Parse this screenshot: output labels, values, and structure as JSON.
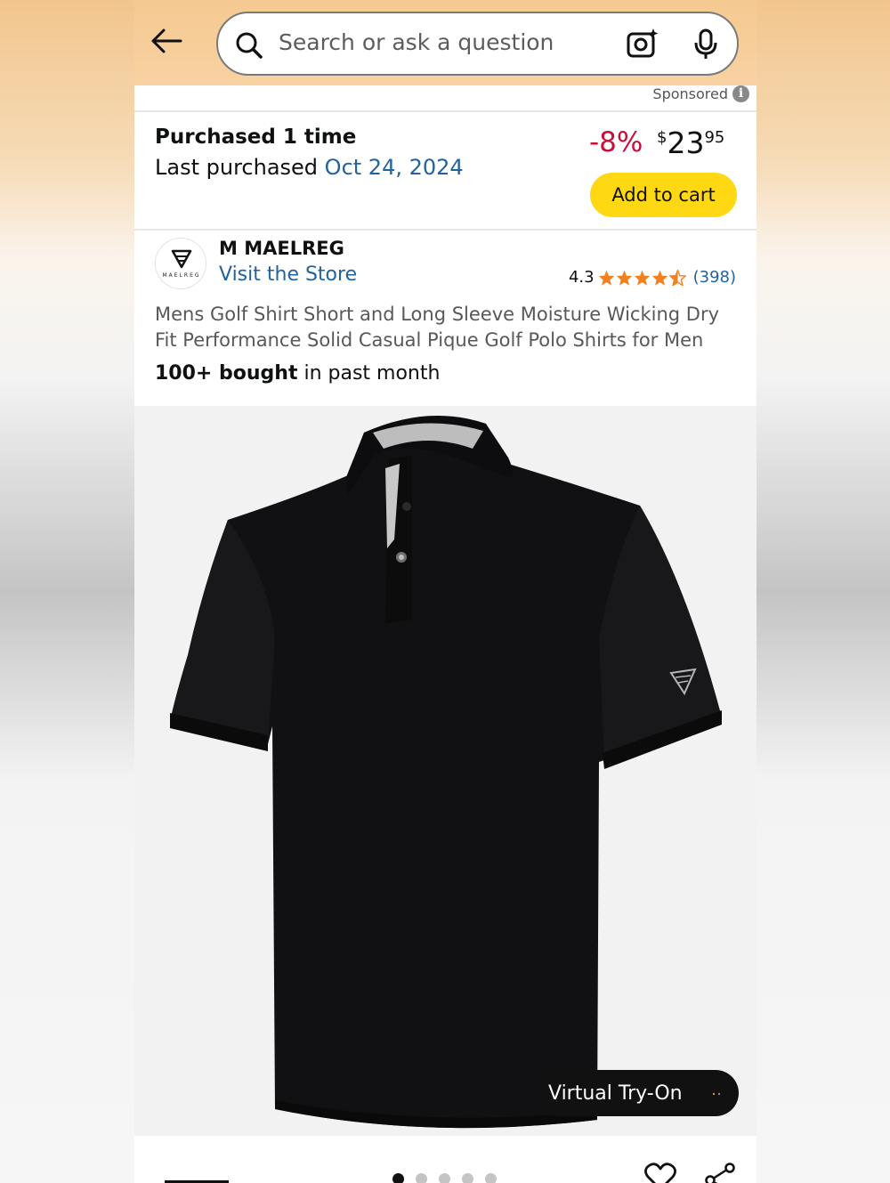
{
  "header": {
    "search_placeholder": "Search or ask a question"
  },
  "sponsored": {
    "label": "Sponsored"
  },
  "purchase": {
    "title": "Purchased 1 time",
    "last_purchased_label": "Last purchased",
    "last_purchased_date": "Oct 24, 2024",
    "discount": "-8%",
    "price_symbol": "$",
    "price_whole": "23",
    "price_fraction": "95",
    "add_to_cart_label": "Add to cart"
  },
  "store": {
    "logo_word": "MAELREG",
    "brand_name": "M MAELREG",
    "visit_label": "Visit the Store",
    "rating": "4.3",
    "review_count": "(398)",
    "rating_stars": 4.3
  },
  "product": {
    "title": "Mens Golf Shirt Short and Long Sleeve Moisture Wicking Dry Fit Performance Solid Casual Pique Golf Polo Shirts for Men",
    "bought_bold": "100+ bought",
    "bought_rest": "in past month",
    "virtual_tryon_label": "Virtual Try-On",
    "image_count": 5,
    "active_image_index": 0
  },
  "colors": {
    "accent_yellow": "#ffd814",
    "link_blue": "#2162a1",
    "discount_red": "#cc0c39",
    "star_orange": "#f3801a"
  }
}
